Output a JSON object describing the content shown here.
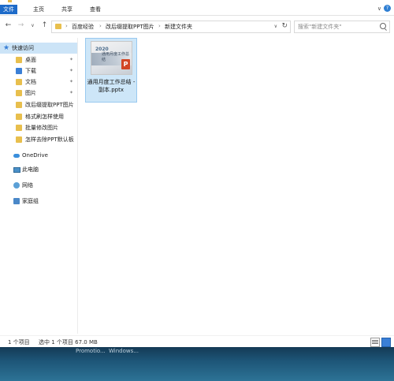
{
  "window": {
    "ribbon_tabs": {
      "file": "文件",
      "home": "主页",
      "share": "共享",
      "view": "查看"
    }
  },
  "nav": {
    "back": "←",
    "forward": "→",
    "dropdown": "∨",
    "up": "↑",
    "breadcrumb": [
      "百度经验",
      "改后缀提取PPT图片",
      "新建文件夹"
    ],
    "refresh": "↻",
    "search_placeholder": "搜索\"新建文件夹\""
  },
  "sidebar": {
    "quick_access": "快速访问",
    "items": [
      {
        "label": "桌面",
        "pinned": true,
        "icon": "desktop-icon"
      },
      {
        "label": "下载",
        "pinned": true,
        "icon": "download-icon"
      },
      {
        "label": "文档",
        "pinned": true,
        "icon": "documents-icon"
      },
      {
        "label": "图片",
        "pinned": true,
        "icon": "pictures-icon"
      },
      {
        "label": "改后缀提取PPT图片",
        "pinned": false,
        "icon": "folder-icon"
      },
      {
        "label": "格式刷怎样使用",
        "pinned": false,
        "icon": "folder-icon"
      },
      {
        "label": "批量修改图片",
        "pinned": false,
        "icon": "folder-icon"
      },
      {
        "label": "怎样去除PPT默认板",
        "pinned": false,
        "icon": "folder-icon"
      }
    ],
    "onedrive": "OneDrive",
    "this_pc": "此电脑",
    "network": "网络",
    "homegroup": "家庭组",
    "pin_glyph": "✦"
  },
  "content": {
    "files": [
      {
        "name": "通用月度工作总结 - 副本.pptx",
        "thumb_year": "2020",
        "thumb_title": "通用月度工作总结",
        "thumb_badge": "P"
      }
    ]
  },
  "status": {
    "count": "1 个项目",
    "selected": "选中 1 个项目  67.0 MB"
  },
  "taskbar": {
    "ghost_labels": [
      "Promotio...",
      "Windows..."
    ]
  },
  "colors": {
    "accent": "#1e6bc9",
    "selection": "#cde6f8",
    "folder": "#e8bf4d",
    "ppt": "#d24625"
  }
}
